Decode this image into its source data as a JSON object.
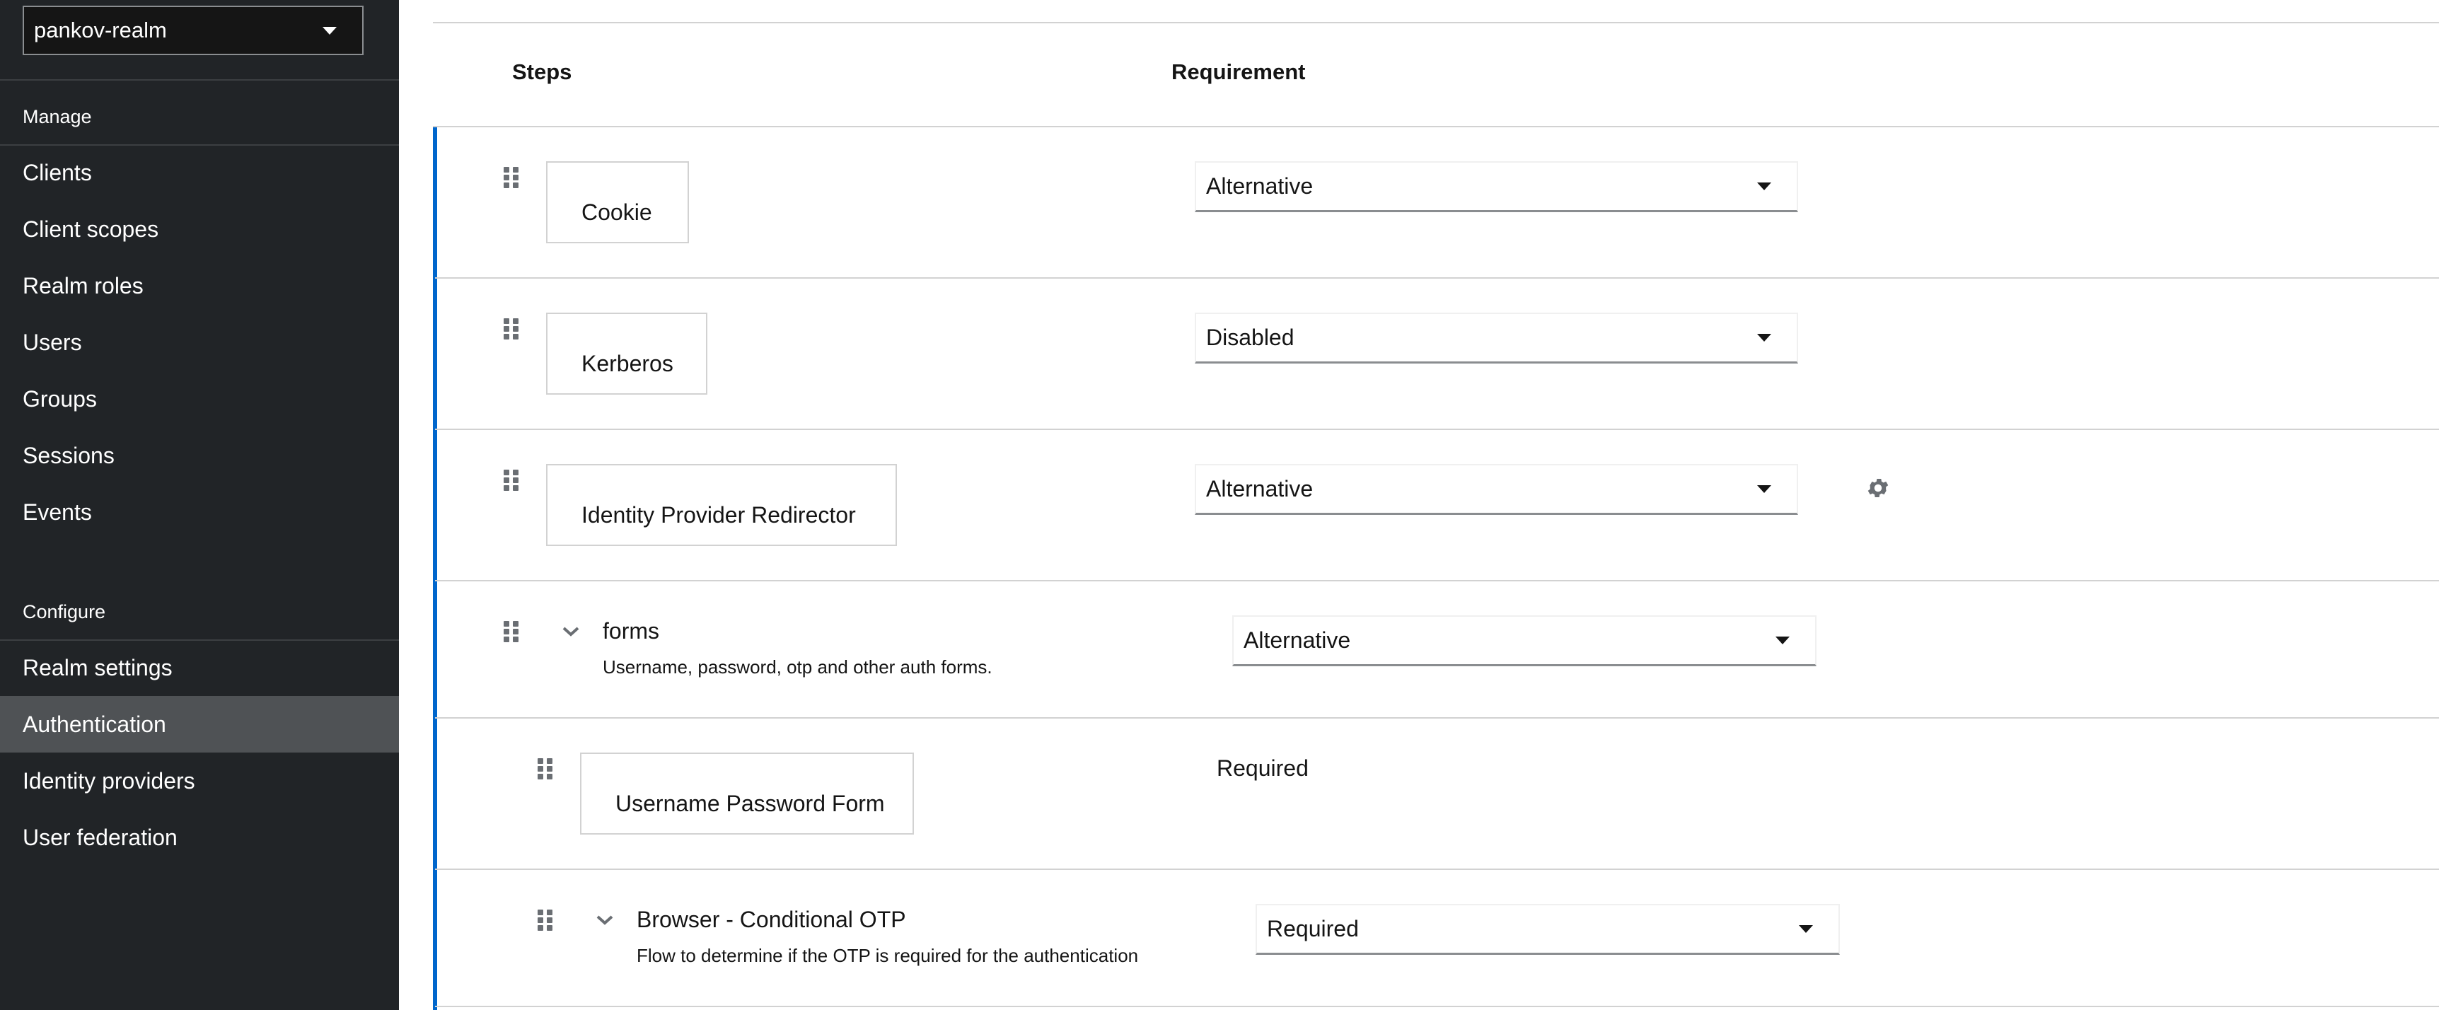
{
  "sidebar": {
    "realm": "pankov-realm",
    "manage_heading": "Manage",
    "manage_items": [
      {
        "label": "Clients"
      },
      {
        "label": "Client scopes"
      },
      {
        "label": "Realm roles"
      },
      {
        "label": "Users"
      },
      {
        "label": "Groups"
      },
      {
        "label": "Sessions"
      },
      {
        "label": "Events"
      }
    ],
    "configure_heading": "Configure",
    "configure_items": [
      {
        "label": "Realm settings"
      },
      {
        "label": "Authentication",
        "active": true
      },
      {
        "label": "Identity providers"
      },
      {
        "label": "User federation"
      }
    ]
  },
  "table": {
    "col_steps": "Steps",
    "col_requirement": "Requirement",
    "rows": [
      {
        "name": "Cookie",
        "requirement": "Alternative"
      },
      {
        "name": "Kerberos",
        "requirement": "Disabled"
      },
      {
        "name": "Identity Provider Redirector",
        "requirement": "Alternative",
        "has_settings": true
      },
      {
        "name": "forms",
        "description": "Username, password, otp and other auth forms.",
        "requirement": "Alternative",
        "is_flow": true
      },
      {
        "name": "Username Password Form",
        "requirement": "Required",
        "static": true
      },
      {
        "name": "Browser - Conditional OTP",
        "description": "Flow to determine if the OTP is required for the authentication",
        "requirement": "Required",
        "is_flow": true
      }
    ]
  },
  "icons": {
    "realm_dropdown": "caret-down-icon",
    "drag": "grip-vertical-icon",
    "select": "caret-down-icon",
    "expand": "chevron-down-icon",
    "settings": "gear-icon"
  },
  "colors": {
    "sidebar_bg": "#212427",
    "sidebar_active": "#4f5255",
    "accent": "#0066cc",
    "border": "#d2d2d2"
  }
}
